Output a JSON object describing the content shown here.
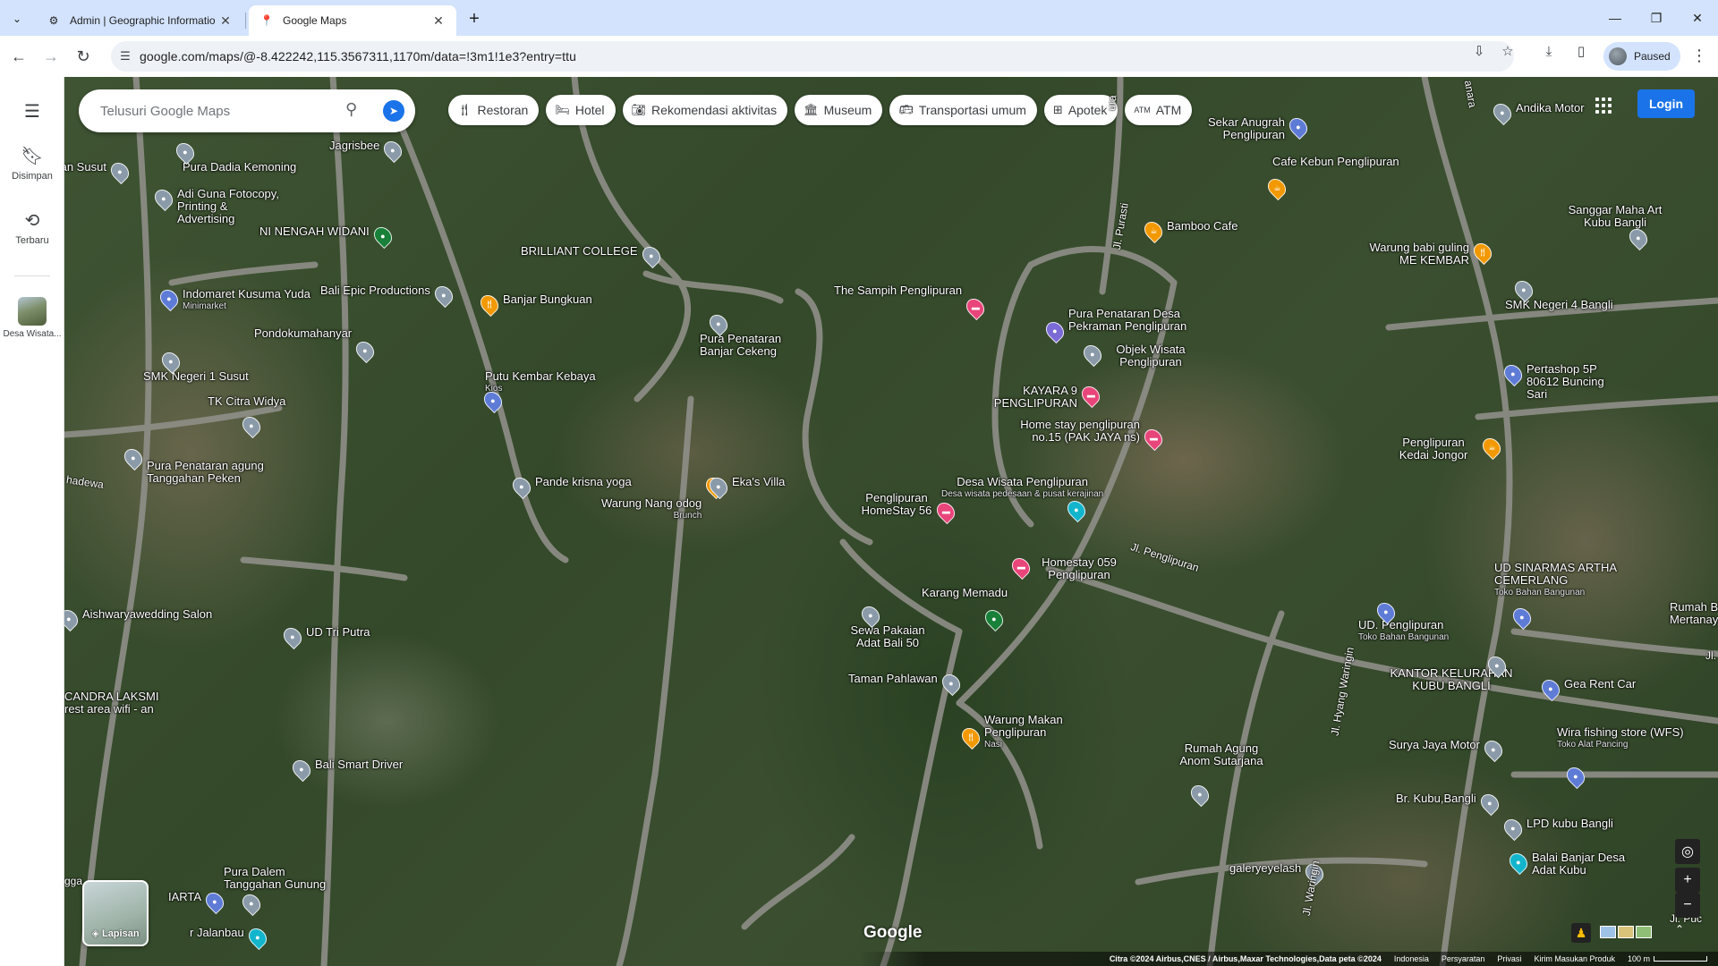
{
  "browser": {
    "tabs": [
      {
        "title": "Admin | Geographic Informatio",
        "icon": "gear-favicon"
      },
      {
        "title": "Google Maps",
        "icon": "maps-pin-favicon"
      }
    ],
    "url": "google.com/maps/@-8.422242,115.3567311,1170m/data=!3m1!1e3?entry=ttu",
    "profile_label": "Paused"
  },
  "rail": {
    "saved_label": "Disimpan",
    "recent_label": "Terbaru",
    "recent_place_label": "Desa Wisata..."
  },
  "search": {
    "placeholder": "Telusuri Google Maps"
  },
  "chips": [
    {
      "label": "Restoran",
      "icon": "fork-knife-icon"
    },
    {
      "label": "Hotel",
      "icon": "bed-icon"
    },
    {
      "label": "Rekomendasi aktivitas",
      "icon": "camera-icon"
    },
    {
      "label": "Museum",
      "icon": "museum-icon"
    },
    {
      "label": "Transportasi umum",
      "icon": "bus-icon"
    },
    {
      "label": "Apotek",
      "icon": "pharmacy-icon"
    },
    {
      "label": "ATM",
      "icon": "atm-icon"
    }
  ],
  "login_label": "Login",
  "places": [
    {
      "name": "Jagrisbee",
      "sub": "",
      "color": "#8a9aa8"
    },
    {
      "name": "Pura Dadia Kemoning",
      "sub": "",
      "color": "#8a9aa8"
    },
    {
      "name": "tan Susut",
      "sub": "",
      "color": "#8a9aa8"
    },
    {
      "name": "Adi Guna Fotocopy, Printing & Advertising",
      "sub": "",
      "color": "#8a9aa8"
    },
    {
      "name": "NI NENGAH WIDANI",
      "sub": "",
      "color": "#188038"
    },
    {
      "name": "BRILLIANT COLLEGE",
      "sub": "",
      "color": "#8a9aa8"
    },
    {
      "name": "Indomaret Kusuma Yuda",
      "sub": "Minimarket",
      "color": "#5e7bd6"
    },
    {
      "name": "Bali Epic Productions",
      "sub": "",
      "color": "#8a9aa8"
    },
    {
      "name": "Banjar Bungkuan",
      "sub": "",
      "color": "#f29900"
    },
    {
      "name": "Pondokumahanyar",
      "sub": "",
      "color": "#8a9aa8"
    },
    {
      "name": "SMK Negeri 1 Susut",
      "sub": "",
      "color": "#8a9aa8"
    },
    {
      "name": "Pura Penataran Banjar Cekeng",
      "sub": "",
      "color": "#8a9aa8"
    },
    {
      "name": "The Sampih Penglipuran",
      "sub": "",
      "color": "#e8457b"
    },
    {
      "name": "Putu Kembar Kebaya",
      "sub": "Kios",
      "color": "#5e7bd6"
    },
    {
      "name": "TK Citra Widya",
      "sub": "",
      "color": "#8a9aa8"
    },
    {
      "name": "Pura Penataran agung Tanggahan Peken",
      "sub": "",
      "color": "#8a9aa8"
    },
    {
      "name": "Pande krisna yoga",
      "sub": "",
      "color": "#8a9aa8"
    },
    {
      "name": "Warung Nang odog",
      "sub": "Brunch",
      "color": "#f29900"
    },
    {
      "name": "Eka's Villa",
      "sub": "",
      "color": "#8a9aa8"
    },
    {
      "name": "Sekar Anugrah Penglipuran",
      "sub": "",
      "color": "#5e7bd6"
    },
    {
      "name": "Andika Motor",
      "sub": "",
      "color": "#8a9aa8"
    },
    {
      "name": "Cafe Kebun Penglipuran",
      "sub": "",
      "color": "#f29900"
    },
    {
      "name": "Bamboo Cafe",
      "sub": "",
      "color": "#f29900"
    },
    {
      "name": "Warung babi guling ME KEMBAR",
      "sub": "",
      "color": "#f29900"
    },
    {
      "name": "Sanggar Maha Art Kubu Bangli",
      "sub": "",
      "color": "#8a9aa8"
    },
    {
      "name": "SMK Negeri 4 Bangli",
      "sub": "",
      "color": "#8a9aa8"
    },
    {
      "name": "Pura Penataran Desa Pekraman Penglipuran",
      "sub": "",
      "color": "#7a6bd6"
    },
    {
      "name": "Objek Wisata Penglipuran",
      "sub": "",
      "color": "#12b5cb"
    },
    {
      "name": "KAYARA 9 PENGLIPURAN",
      "sub": "",
      "color": "#e8457b"
    },
    {
      "name": "Home stay penglipuran no.15 (PAK JAYA ns)",
      "sub": "",
      "color": "#e8457b"
    },
    {
      "name": "Pertashop 5P 80612 Buncing Sari",
      "sub": "",
      "color": "#5e7bd6"
    },
    {
      "name": "Penglipuran Kedai Jongor",
      "sub": "",
      "color": "#f29900"
    },
    {
      "name": "Desa Wisata Penglipuran",
      "sub": "Desa wisata pedesaan & pusat kerajinan",
      "color": "#12b5cb"
    },
    {
      "name": "Penglipuran HomeStay 56",
      "sub": "",
      "color": "#e8457b"
    },
    {
      "name": "Homestay 059 Penglipuran",
      "sub": "",
      "color": "#e8457b"
    },
    {
      "name": "Karang Memadu",
      "sub": "",
      "color": "#188038"
    },
    {
      "name": "Sewa Pakaian Adat Bali 50",
      "sub": "",
      "color": "#8a9aa8"
    },
    {
      "name": "Taman Pahlawan",
      "sub": "",
      "color": "#8a9aa8"
    },
    {
      "name": "Warung Makan Penglipuran",
      "sub": "Nasi",
      "color": "#f29900"
    },
    {
      "name": "Aishwaryawedding Salon",
      "sub": "",
      "color": "#8a9aa8"
    },
    {
      "name": "UD Tri Putra",
      "sub": "",
      "color": "#8a9aa8"
    },
    {
      "name": "CANDRA LAKSMI rest area wifi - an",
      "sub": "",
      "color": "#8a9aa8"
    },
    {
      "name": "Bali Smart Driver",
      "sub": "",
      "color": "#8a9aa8"
    },
    {
      "name": "UD SINARMAS ARTHA CEMERLANG",
      "sub": "Toko Bahan Bangunan",
      "color": "#5e7bd6"
    },
    {
      "name": "UD. Penglipuran",
      "sub": "Toko Bahan Bangunan",
      "color": "#5e7bd6"
    },
    {
      "name": "Rumah B Mertanay",
      "sub": "",
      "color": "#8a9aa8"
    },
    {
      "name": "KANTOR KELURAHAN KUBU BANGLI",
      "sub": "",
      "color": "#8a9aa8"
    },
    {
      "name": "Gea Rent Car",
      "sub": "",
      "color": "#5e7bd6"
    },
    {
      "name": "Surya Jaya Motor",
      "sub": "",
      "color": "#8a9aa8"
    },
    {
      "name": "Wira fishing store (WFS)",
      "sub": "Toko Alat Pancing",
      "color": "#5e7bd6"
    },
    {
      "name": "Rumah Agung Anom Sutarjana",
      "sub": "",
      "color": "#8a9aa8"
    },
    {
      "name": "Br. Kubu,Bangli",
      "sub": "",
      "color": "#8a9aa8"
    },
    {
      "name": "LPD kubu Bangli",
      "sub": "",
      "color": "#8a9aa8"
    },
    {
      "name": "Balai Banjar Desa Adat Kubu",
      "sub": "",
      "color": "#12b5cb"
    },
    {
      "name": "galeryeyelash",
      "sub": "",
      "color": "#8a9aa8"
    },
    {
      "name": "Pura Dalem Tanggahan Gunung",
      "sub": "",
      "color": "#8a9aa8"
    },
    {
      "name": "IARTA",
      "sub": "",
      "color": "#5e7bd6"
    },
    {
      "name": "r Jalanbau",
      "sub": "",
      "color": "#12b5cb"
    }
  ],
  "streets": [
    "Jl. Purasti",
    "Jl. Penglipuran",
    "Jl. Hyang Waringin",
    "hadewa",
    "anara",
    "ura",
    "Jl.",
    "gga",
    "Jl. Puc",
    "Jl. Waringin"
  ],
  "layers_label": "Lapisan",
  "google_logo": "Google",
  "attribution": {
    "imagery": "Citra ©2024 Airbus,CNES / Airbus,Maxar Technologies,Data peta ©2024",
    "country": "Indonesia",
    "terms": "Persyaratan",
    "privacy": "Privasi",
    "feedback": "Kirim Masukan Produk",
    "scale": "100 m"
  }
}
